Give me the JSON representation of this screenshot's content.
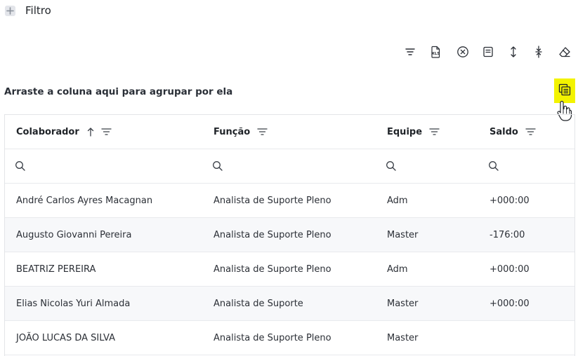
{
  "filter": {
    "label": "Filtro",
    "icon": "plus-icon"
  },
  "toolbar": {
    "items": [
      "filter-lines-icon",
      "export-xls-icon",
      "clear-filter-icon",
      "notes-icon",
      "expand-rows-icon",
      "collapse-rows-icon",
      "eraser-icon"
    ]
  },
  "group_hint": "Arraste a coluna aqui para agrupar por ela",
  "column_chooser": {
    "icon": "column-chooser-icon",
    "highlight": "#f3f300"
  },
  "grid": {
    "columns": [
      {
        "label": "Colaborador",
        "sorted": "asc"
      },
      {
        "label": "Função"
      },
      {
        "label": "Equipe"
      },
      {
        "label": "Saldo"
      }
    ],
    "rows": [
      [
        "André Carlos Ayres Macagnan",
        "Analista de Suporte Pleno",
        "Adm",
        "+000:00"
      ],
      [
        "Augusto Giovanni Pereira",
        "Analista de Suporte Pleno",
        "Master",
        "-176:00"
      ],
      [
        "BEATRIZ PEREIRA",
        "Analista de Suporte Pleno",
        "Adm",
        "+000:00"
      ],
      [
        "Elias Nicolas Yuri Almada",
        "Analista de Suporte",
        "Master",
        "+000:00"
      ],
      [
        "JOÃO LUCAS DA SILVA",
        "Analista de Suporte Pleno",
        "Master",
        ""
      ]
    ]
  }
}
